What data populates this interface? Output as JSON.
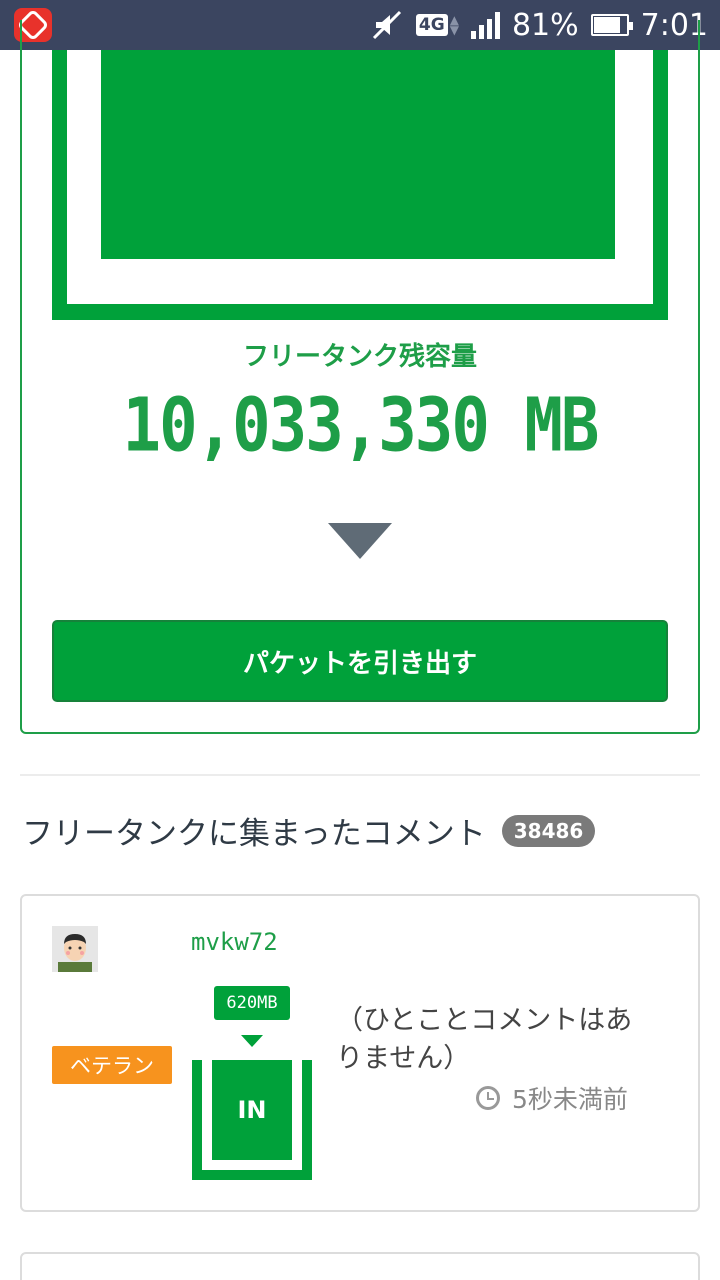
{
  "status_bar": {
    "battery_percent": "81%",
    "time": "7:01",
    "network": "4G"
  },
  "tank": {
    "label": "フリータンク残容量",
    "value": "10,033,330 MB",
    "withdraw_button": "パケットを引き出す"
  },
  "comments": {
    "heading": "フリータンクに集まったコメント",
    "count": "38486",
    "items": [
      {
        "username": "mvkw72",
        "badge": "ベテラン",
        "amount": "620MB",
        "direction": "IN",
        "text": "（ひとことコメントはありません）",
        "timestamp": "5秒未満前"
      }
    ]
  },
  "colors": {
    "brand_green": "#00a13a",
    "status_bar": "#3b4560",
    "veteran_orange": "#f7931e"
  }
}
